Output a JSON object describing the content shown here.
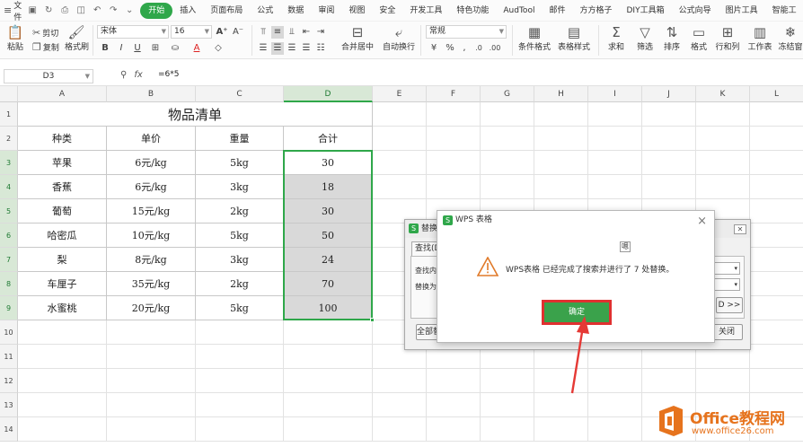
{
  "menubar": {
    "file_label": "文件",
    "items": [
      "开始",
      "插入",
      "页面布局",
      "公式",
      "数据",
      "审阅",
      "视图",
      "安全",
      "开发工具",
      "特色功能",
      "AudTool",
      "邮件",
      "方方格子",
      "DIY工具箱",
      "公式向导",
      "图片工具",
      "智能工"
    ],
    "active_index": 0
  },
  "ribbon": {
    "paste": "粘贴",
    "cut": "剪切",
    "copy": "复制",
    "format_painter": "格式刷",
    "font_name": "宋体",
    "font_size": "16",
    "bold": "B",
    "italic": "I",
    "underline": "U",
    "merge_center": "合并居中",
    "wrap": "自动换行",
    "number_format": "常规",
    "percent": "%",
    "conditional_format": "条件格式",
    "table_style": "表格样式",
    "sum": "求和",
    "filter": "筛选",
    "sort": "排序",
    "format": "格式",
    "rows_cols": "行和列",
    "worksheet": "工作表",
    "freeze": "冻结窗"
  },
  "formula_bar": {
    "cell_ref": "D3",
    "fx": "fx",
    "formula": "=6*5"
  },
  "sheet": {
    "columns": [
      "A",
      "B",
      "C",
      "D",
      "E",
      "F",
      "G",
      "H",
      "I",
      "J",
      "K",
      "L"
    ],
    "rows": [
      "1",
      "2",
      "3",
      "4",
      "5",
      "6",
      "7",
      "8",
      "9",
      "10",
      "11",
      "12",
      "13",
      "14"
    ],
    "title": "物品清单",
    "headers": [
      "种类",
      "单价",
      "重量",
      "合计"
    ],
    "data": [
      [
        "苹果",
        "6元/kg",
        "5kg",
        "30"
      ],
      [
        "香蕉",
        "6元/kg",
        "3kg",
        "18"
      ],
      [
        "葡萄",
        "15元/kg",
        "2kg",
        "30"
      ],
      [
        "哈密瓜",
        "10元/kg",
        "5kg",
        "50"
      ],
      [
        "梨",
        "8元/kg",
        "3kg",
        "24"
      ],
      [
        "车厘子",
        "35元/kg",
        "2kg",
        "70"
      ],
      [
        "水蜜桃",
        "20元/kg",
        "5kg",
        "100"
      ]
    ]
  },
  "replace_dialog": {
    "title": "替换",
    "tab": "查找(D)",
    "find_label": "查找内容",
    "replace_label": "替换为",
    "find_all": "全部替换",
    "next": "D >>",
    "close": "关闭"
  },
  "message_dialog": {
    "title": "WPS 表格",
    "ime": "嗯",
    "message": "WPS表格 已经完成了搜索并进行了 7 处替换。",
    "ok": "确定"
  },
  "watermark": {
    "brand": "Office教程网",
    "url": "www.office26.com"
  }
}
